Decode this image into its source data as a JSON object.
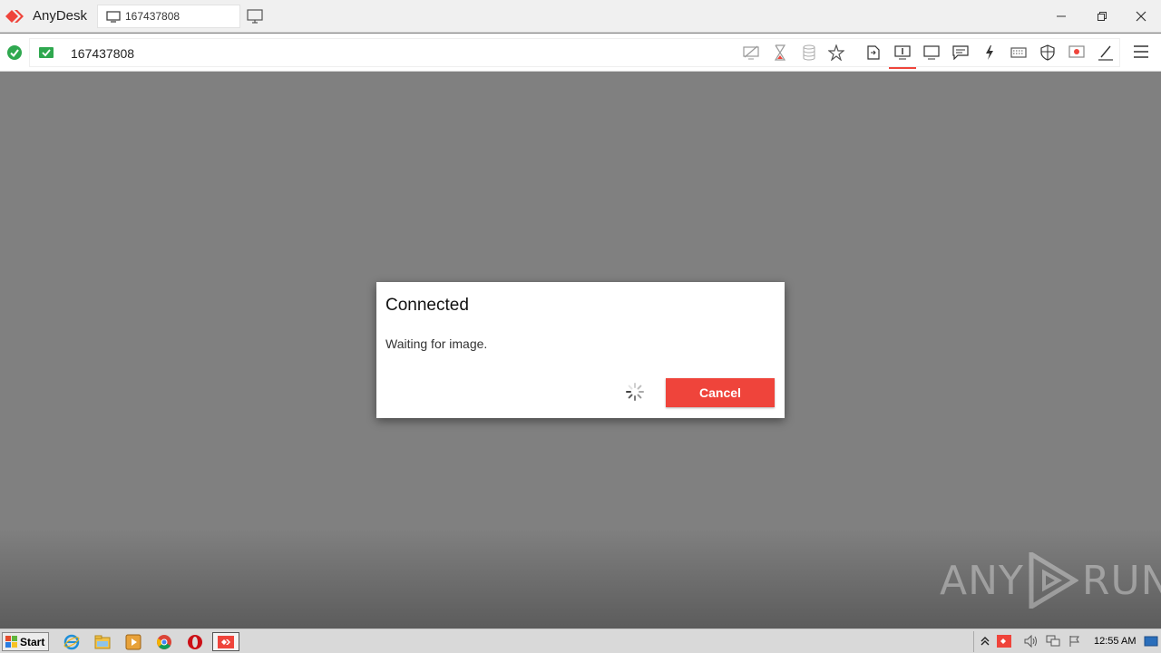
{
  "app": {
    "name": "AnyDesk",
    "brand_color": "#ef443b"
  },
  "tab": {
    "label": "167437808",
    "icon": "monitor-icon"
  },
  "address": {
    "value": "167437808"
  },
  "toolbar_icons": [
    "hide-screen-icon",
    "hourglass-icon",
    "database-icon",
    "star-icon",
    "file-transfer-icon",
    "monitor-1-icon",
    "display-icon",
    "chat-icon",
    "lightning-icon",
    "keyboard-icon",
    "permissions-shield-icon",
    "record-icon",
    "pen-icon",
    "hamburger-menu-icon"
  ],
  "dialog": {
    "title": "Connected",
    "message": "Waiting for image.",
    "cancel_label": "Cancel"
  },
  "watermark": {
    "left": "ANY",
    "right": "RUN"
  },
  "taskbar": {
    "start_label": "Start",
    "apps": [
      "internet-explorer-icon",
      "file-explorer-icon",
      "media-player-icon",
      "chrome-icon",
      "opera-icon",
      "anydesk-icon"
    ],
    "clock": "12:55 AM"
  }
}
